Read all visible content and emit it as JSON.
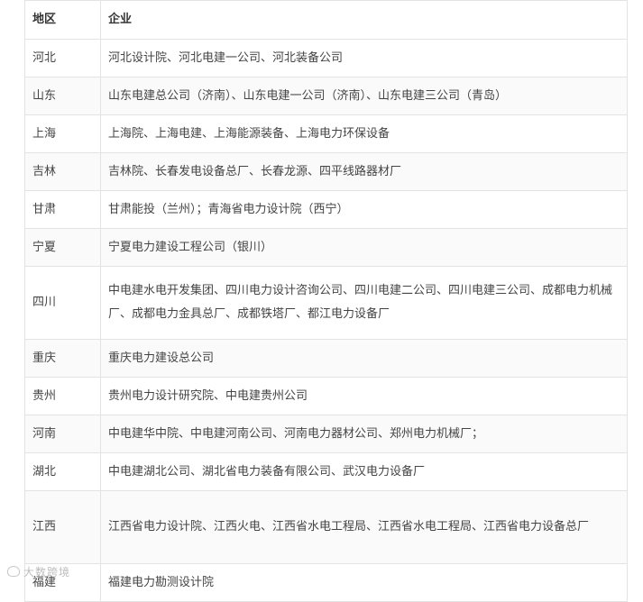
{
  "table": {
    "headers": {
      "region": "地区",
      "company": "企业"
    },
    "rows": [
      {
        "region": "河北",
        "company": "河北设计院、河北电建一公司、河北装备公司"
      },
      {
        "region": "山东",
        "company": "山东电建总公司（济南）、山东电建一公司（济南）、山东电建三公司（青岛）"
      },
      {
        "region": "上海",
        "company": "上海院、上海电建、上海能源装备、上海电力环保设备"
      },
      {
        "region": "吉林",
        "company": "吉林院、长春发电设备总厂、长春龙源、四平线路器材厂"
      },
      {
        "region": "甘肃",
        "company": "甘肃能投（兰州）；青海省电力设计院（西宁）"
      },
      {
        "region": "宁夏",
        "company": "宁夏电力建设工程公司（银川）"
      },
      {
        "region": "四川",
        "company": "中电建水电开发集团、四川电力设计咨询公司、四川电建二公司、四川电建三公司、成都电力机械厂、成都电力金具总厂、成都铁塔厂、都江电力设备厂"
      },
      {
        "region": "重庆",
        "company": "重庆电力建设总公司"
      },
      {
        "region": "贵州",
        "company": "贵州电力设计研究院、中电建贵州公司"
      },
      {
        "region": "河南",
        "company": "中电建华中院、中电建河南公司、河南电力器材公司、郑州电力机械厂；"
      },
      {
        "region": "湖北",
        "company": "中电建湖北公司、湖北省电力装备有限公司、武汉电力设备厂"
      },
      {
        "region": "江西",
        "company": "江西省电力设计院、江西火电、江西省水电工程局、江西省水电工程局、江西省电力设备总厂"
      },
      {
        "region": "福建",
        "company": "福建电力勘测设计院"
      }
    ]
  },
  "watermark": {
    "text": "大数跨境"
  }
}
